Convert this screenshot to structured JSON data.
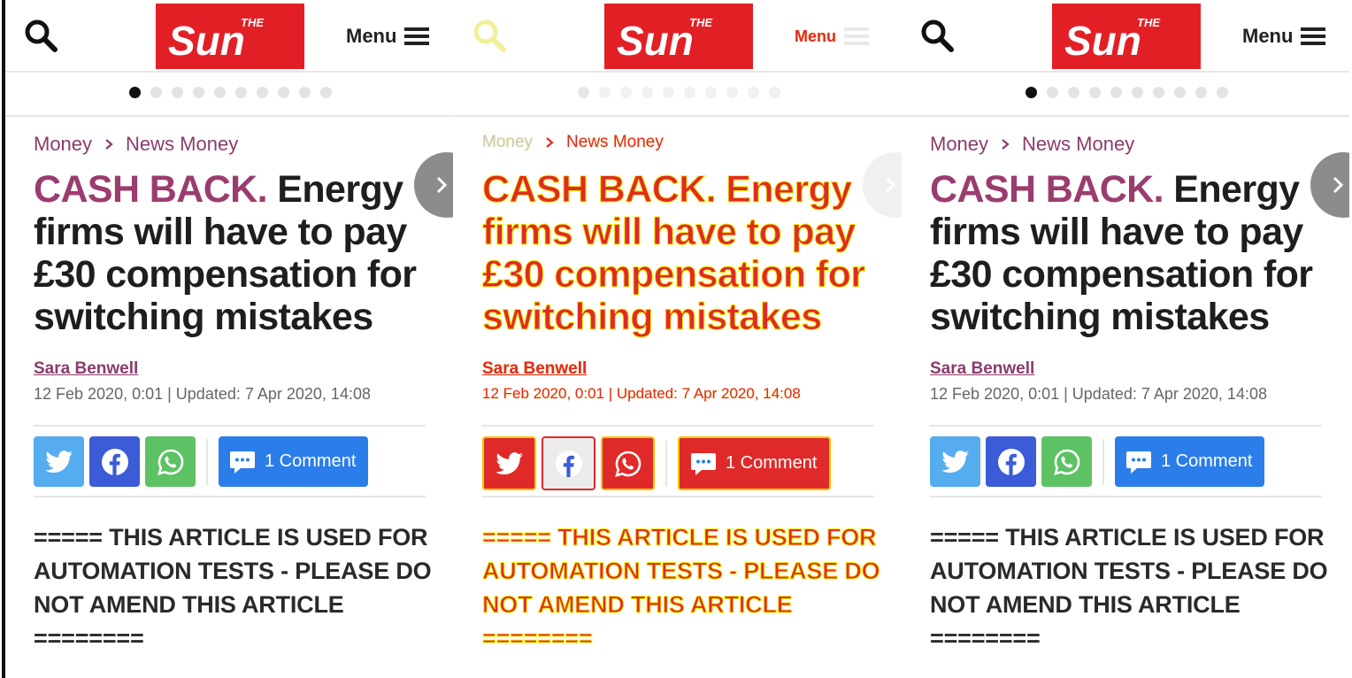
{
  "panels": [
    {
      "variant": "baseline",
      "header": {
        "logo_text": "Sun",
        "logo_small": "THE",
        "menu_label": "Menu"
      },
      "carousel": {
        "dot_count": 10,
        "active_index": 0
      },
      "breadcrumb": {
        "section": "Money",
        "subsection": "News Money"
      },
      "headline": {
        "kicker": "CASH BACK.",
        "text": " Energy firms will have to pay £30 compensation for switching mistakes"
      },
      "byline": {
        "author": "Sara Benwell",
        "dates": "12 Feb 2020, 0:01 | Updated: 7 Apr 2020, 14:08"
      },
      "share": {
        "comment_label": "1 Comment"
      },
      "body": {
        "notice": "===== THIS ARTICLE IS USED FOR AUTOMATION TESTS - PLEASE DO NOT AMEND THIS ARTICLE ========"
      }
    },
    {
      "variant": "diff",
      "header": {
        "logo_text": "Sun",
        "logo_small": "THE",
        "menu_label": "Menu"
      },
      "carousel": {
        "dot_count": 10,
        "active_index": 0
      },
      "breadcrumb": {
        "section": "Money",
        "subsection": "News Money"
      },
      "headline": {
        "kicker": "CASH BACK.",
        "text": " Energy firms will have to pay £30 compensation for switching mistakes"
      },
      "byline": {
        "author": "Sara Benwell",
        "dates": "12 Feb 2020, 0:01 | Updated: 7 Apr 2020, 14:08"
      },
      "share": {
        "comment_label": "1 Comment"
      },
      "body": {
        "notice": "===== THIS ARTICLE IS USED FOR AUTOMATION TESTS - PLEASE DO NOT AMEND THIS ARTICLE ========"
      }
    },
    {
      "variant": "current",
      "header": {
        "logo_text": "Sun",
        "logo_small": "THE",
        "menu_label": "Menu"
      },
      "carousel": {
        "dot_count": 10,
        "active_index": 0
      },
      "breadcrumb": {
        "section": "Money",
        "subsection": "News Money"
      },
      "headline": {
        "kicker": "CASH BACK.",
        "text": " Energy firms will have to pay £30 compensation for switching mistakes"
      },
      "byline": {
        "author": "Sara Benwell",
        "dates": "12 Feb 2020, 0:01 | Updated: 7 Apr 2020, 14:08"
      },
      "share": {
        "comment_label": "1 Comment"
      },
      "body": {
        "notice": "===== THIS ARTICLE IS USED FOR AUTOMATION TESTS - PLEASE DO NOT AMEND THIS ARTICLE ========"
      }
    }
  ],
  "colors": {
    "brand_red": "#e31f26",
    "section_purple": "#8a3b6c",
    "twitter": "#55acee",
    "facebook": "#3b5bd7",
    "whatsapp": "#5dc263",
    "comment_blue": "#2b7de9",
    "diff_red": "#e02a2a",
    "diff_yellow": "#f4f400"
  }
}
